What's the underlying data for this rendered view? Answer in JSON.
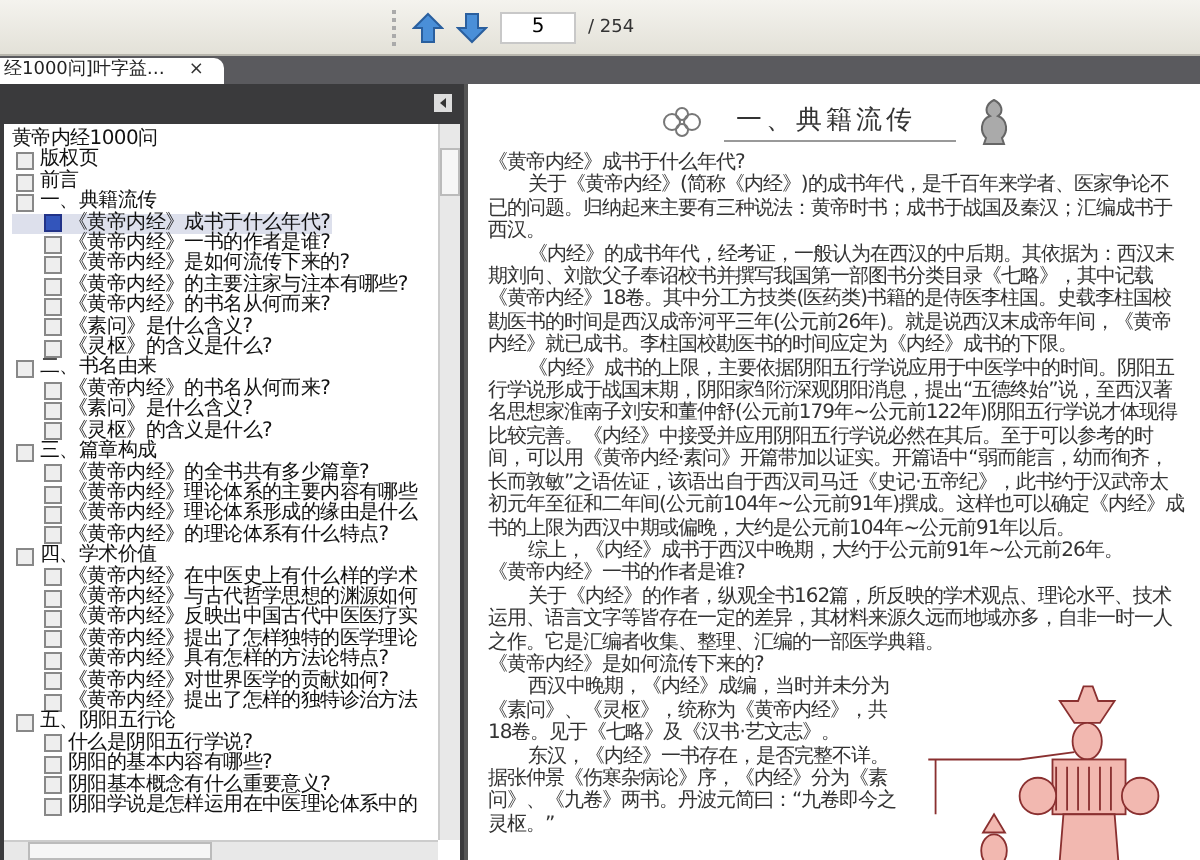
{
  "toolbar": {
    "page_number": "5",
    "page_total": "/ 254"
  },
  "tab": {
    "title": "经1000问]叶字益…",
    "close": "×"
  },
  "outline": {
    "label": "黄帝内经1000问",
    "selected": false,
    "children": [
      {
        "label": "版权页",
        "selected": false
      },
      {
        "label": "前言",
        "selected": false
      },
      {
        "label": "一、典籍流传",
        "selected": false,
        "children": [
          {
            "label": "《黄帝内经》成书于什么年代?",
            "selected": true
          },
          {
            "label": "《黄帝内经》一书的作者是谁?",
            "selected": false
          },
          {
            "label": "《黄帝内经》是如何流传下来的?",
            "selected": false
          },
          {
            "label": "《黄帝内经》的主要注家与注本有哪些?",
            "selected": false
          },
          {
            "label": "《黄帝内经》的书名从何而来?",
            "selected": false
          },
          {
            "label": "《素问》是什么含义?",
            "selected": false
          },
          {
            "label": "《灵枢》的含义是什么?",
            "selected": false
          }
        ]
      },
      {
        "label": "二、书名由来",
        "selected": false,
        "children": [
          {
            "label": "《黄帝内经》的书名从何而来?",
            "selected": false
          },
          {
            "label": "《素问》是什么含义?",
            "selected": false
          },
          {
            "label": "《灵枢》的含义是什么?",
            "selected": false
          }
        ]
      },
      {
        "label": "三、篇章构成",
        "selected": false,
        "children": [
          {
            "label": "《黄帝内经》的全书共有多少篇章?",
            "selected": false
          },
          {
            "label": "《黄帝内经》理论体系的主要内容有哪些",
            "selected": false
          },
          {
            "label": "《黄帝内经》理论体系形成的缘由是什么",
            "selected": false
          },
          {
            "label": "《黄帝内经》的理论体系有什么特点?",
            "selected": false
          }
        ]
      },
      {
        "label": "四、学术价值",
        "selected": false,
        "children": [
          {
            "label": "《黄帝内经》在中医史上有什么样的学术",
            "selected": false
          },
          {
            "label": "《黄帝内经》与古代哲学思想的渊源如何",
            "selected": false
          },
          {
            "label": "《黄帝内经》反映出中国古代中医医疗实",
            "selected": false
          },
          {
            "label": "《黄帝内经》提出了怎样独特的医学理论",
            "selected": false
          },
          {
            "label": "《黄帝内经》具有怎样的方法论特点?",
            "selected": false
          },
          {
            "label": "《黄帝内经》对世界医学的贡献如何?",
            "selected": false
          },
          {
            "label": "《黄帝内经》提出了怎样的独特诊治方法",
            "selected": false
          }
        ]
      },
      {
        "label": "五、阴阳五行论",
        "selected": false,
        "children": [
          {
            "label": "什么是阴阳五行学说?",
            "selected": false
          },
          {
            "label": "阴阳的基本内容有哪些?",
            "selected": false
          },
          {
            "label": "阴阳基本概念有什么重要意义?",
            "selected": false
          },
          {
            "label": "阴阳学说是怎样运用在中医理论体系中的",
            "selected": false
          }
        ]
      }
    ]
  },
  "page": {
    "heading": "一、典籍流传",
    "blocks": [
      {
        "kind": "question",
        "text": "《黄帝内经》成书于什么年代?"
      },
      {
        "kind": "paragraph",
        "text": "关于《黄帝内经》(简称《内经》)的成书年代，是千百年来学者、医家争论不已的问题。归纳起来主要有三种说法：黄帝时书；成书于战国及秦汉；汇编成书于西汉。"
      },
      {
        "kind": "paragraph",
        "text": "《内经》的成书年代，经考证，一般认为在西汉的中后期。其依据为：西汉末期刘向、刘歆父子奉诏校书并撰写我国第一部图书分类目录《七略》，其中记载《黄帝内经》18卷。其中分工方技类(医药类)书籍的是侍医李柱国。史载李柱国校勘医书的时间是西汉成帝河平三年(公元前26年)。就是说西汉末成帝年间，《黄帝内经》就已成书。李柱国校勘医书的时间应定为《内经》成书的下限。"
      },
      {
        "kind": "paragraph",
        "text": "《内经》成书的上限，主要依据阴阳五行学说应用于中医学中的时间。阴阳五行学说形成于战国末期，阴阳家邹衍深观阴阳消息，提出“五德终始”说，至西汉著名思想家淮南子刘安和董仲舒(公元前179年~公元前122年)阴阳五行学说才体现得比较完善。《内经》中接受并应用阴阳五行学说必然在其后。至于可以参考的时间，可以用《黄帝内经·素问》开篇带加以证实。开篇语中“弱而能言，幼而徇齐，长而敦敏”之语佐证，该语出自于西汉司马迁《史记·五帝纪》，此书约于汉武帝太初元年至征和二年间(公元前104年~公元前91年)撰成。这样也可以确定《内经》成书的上限为西汉中期或偏晚，大约是公元前104年~公元前91年以后。"
      },
      {
        "kind": "paragraph",
        "text": "综上，《内经》成书于西汉中晚期，大约于公元前91年~公元前26年。"
      },
      {
        "kind": "question",
        "text": "《黄帝内经》一书的作者是谁?"
      },
      {
        "kind": "paragraph",
        "text": "关于《内经》的作者，纵观全书162篇，所反映的学术观点、理论水平、技术运用、语言文字等皆存在一定的差异，其材料来源久远而地域亦多，自非一时一人之作。它是汇编者收集、整理、汇编的一部医学典籍。"
      },
      {
        "kind": "question",
        "text": "《黄帝内经》是如何流传下来的?"
      }
    ],
    "side_blocks": [
      {
        "kind": "paragraph",
        "text": "西汉中晚期，《内经》成编，当时并未分为《素问》、《灵枢》，统称为《黄帝内经》，共18卷。见于《七略》及《汉书·艺文志》。"
      },
      {
        "kind": "paragraph",
        "text": "东汉，《内经》一书存在，是否完整不详。据张仲景《伤寒杂病论》序，《内经》分为《素问》、《九卷》两书。丹波元简曰：“九卷即今之灵枢。”"
      }
    ]
  }
}
